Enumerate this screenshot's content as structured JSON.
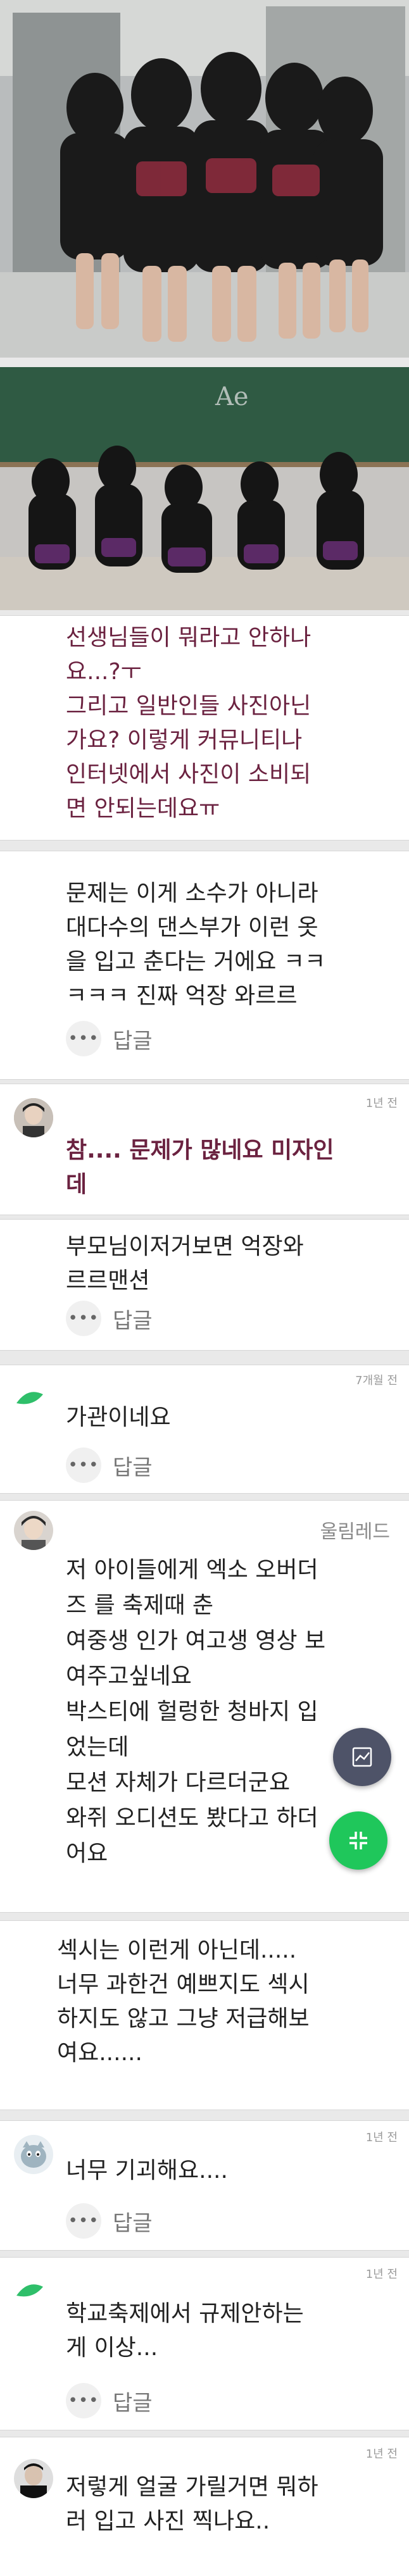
{
  "colors": {
    "accent_green": "#1fc75b",
    "fab_dark": "#4e5368",
    "purple_text": "#6b2240"
  },
  "ui": {
    "reply_label": "답글",
    "more_glyph": "•••"
  },
  "comments": [
    {
      "text": "선생님들이 뭐라고 안하나\n요...?ㅜ\n그리고 일반인들 사진아닌\n가요? 이렇게 커뮤니티나\n인터넷에서 사진이 소비되\n면 안되는데요ㅠ",
      "time": "",
      "user": "",
      "style": "purple"
    },
    {
      "text": "문제는 이게 소수가 아니라\n대다수의 댄스부가 이런 옷\n을 입고 춘다는 거에요 ㅋㅋ\nㅋㅋㅋ 진짜 억장 와르르",
      "time": "",
      "user": "",
      "style": "normal"
    },
    {
      "text": "참.... 문제가 많네요 미자인\n데",
      "time": "1년 전",
      "user": "",
      "style": "purple-bold"
    },
    {
      "text": "부모님이저거보면 억장와\n르르맨션",
      "time": "",
      "user": "",
      "style": "normal"
    },
    {
      "text": "가관이네요",
      "time": "7개월 전",
      "user": "",
      "style": "normal"
    },
    {
      "text": "저 아이들에게 엑소 오버더\n즈 를 축제때 춘\n여중생 인가 여고생 영상 보\n여주고싶네요\n박스티에 헐렁한 청바지 입\n었는데\n모션 자체가 다르더군요\n와쥐 오디션도 봤다고 하더\n어요",
      "time": "",
      "user": "울림레드",
      "style": "normal"
    },
    {
      "text": "섹시는 이런게 아닌데.....\n너무 과한건 예쁘지도 섹시\n하지도 않고 그냥 저급해보\n여요......",
      "time": "",
      "user": "",
      "style": "normal"
    },
    {
      "text": "너무 기괴해요....",
      "time": "1년 전",
      "user": "",
      "style": "normal"
    },
    {
      "text": "학교축제에서 규제안하는\n게 이상...",
      "time": "1년 전",
      "user": "",
      "style": "normal"
    },
    {
      "text": "저렇게 얼굴 가릴거면 뭐하\n러 입고 사진 찍나요..",
      "time": "1년 전",
      "user": "",
      "style": "normal"
    }
  ]
}
